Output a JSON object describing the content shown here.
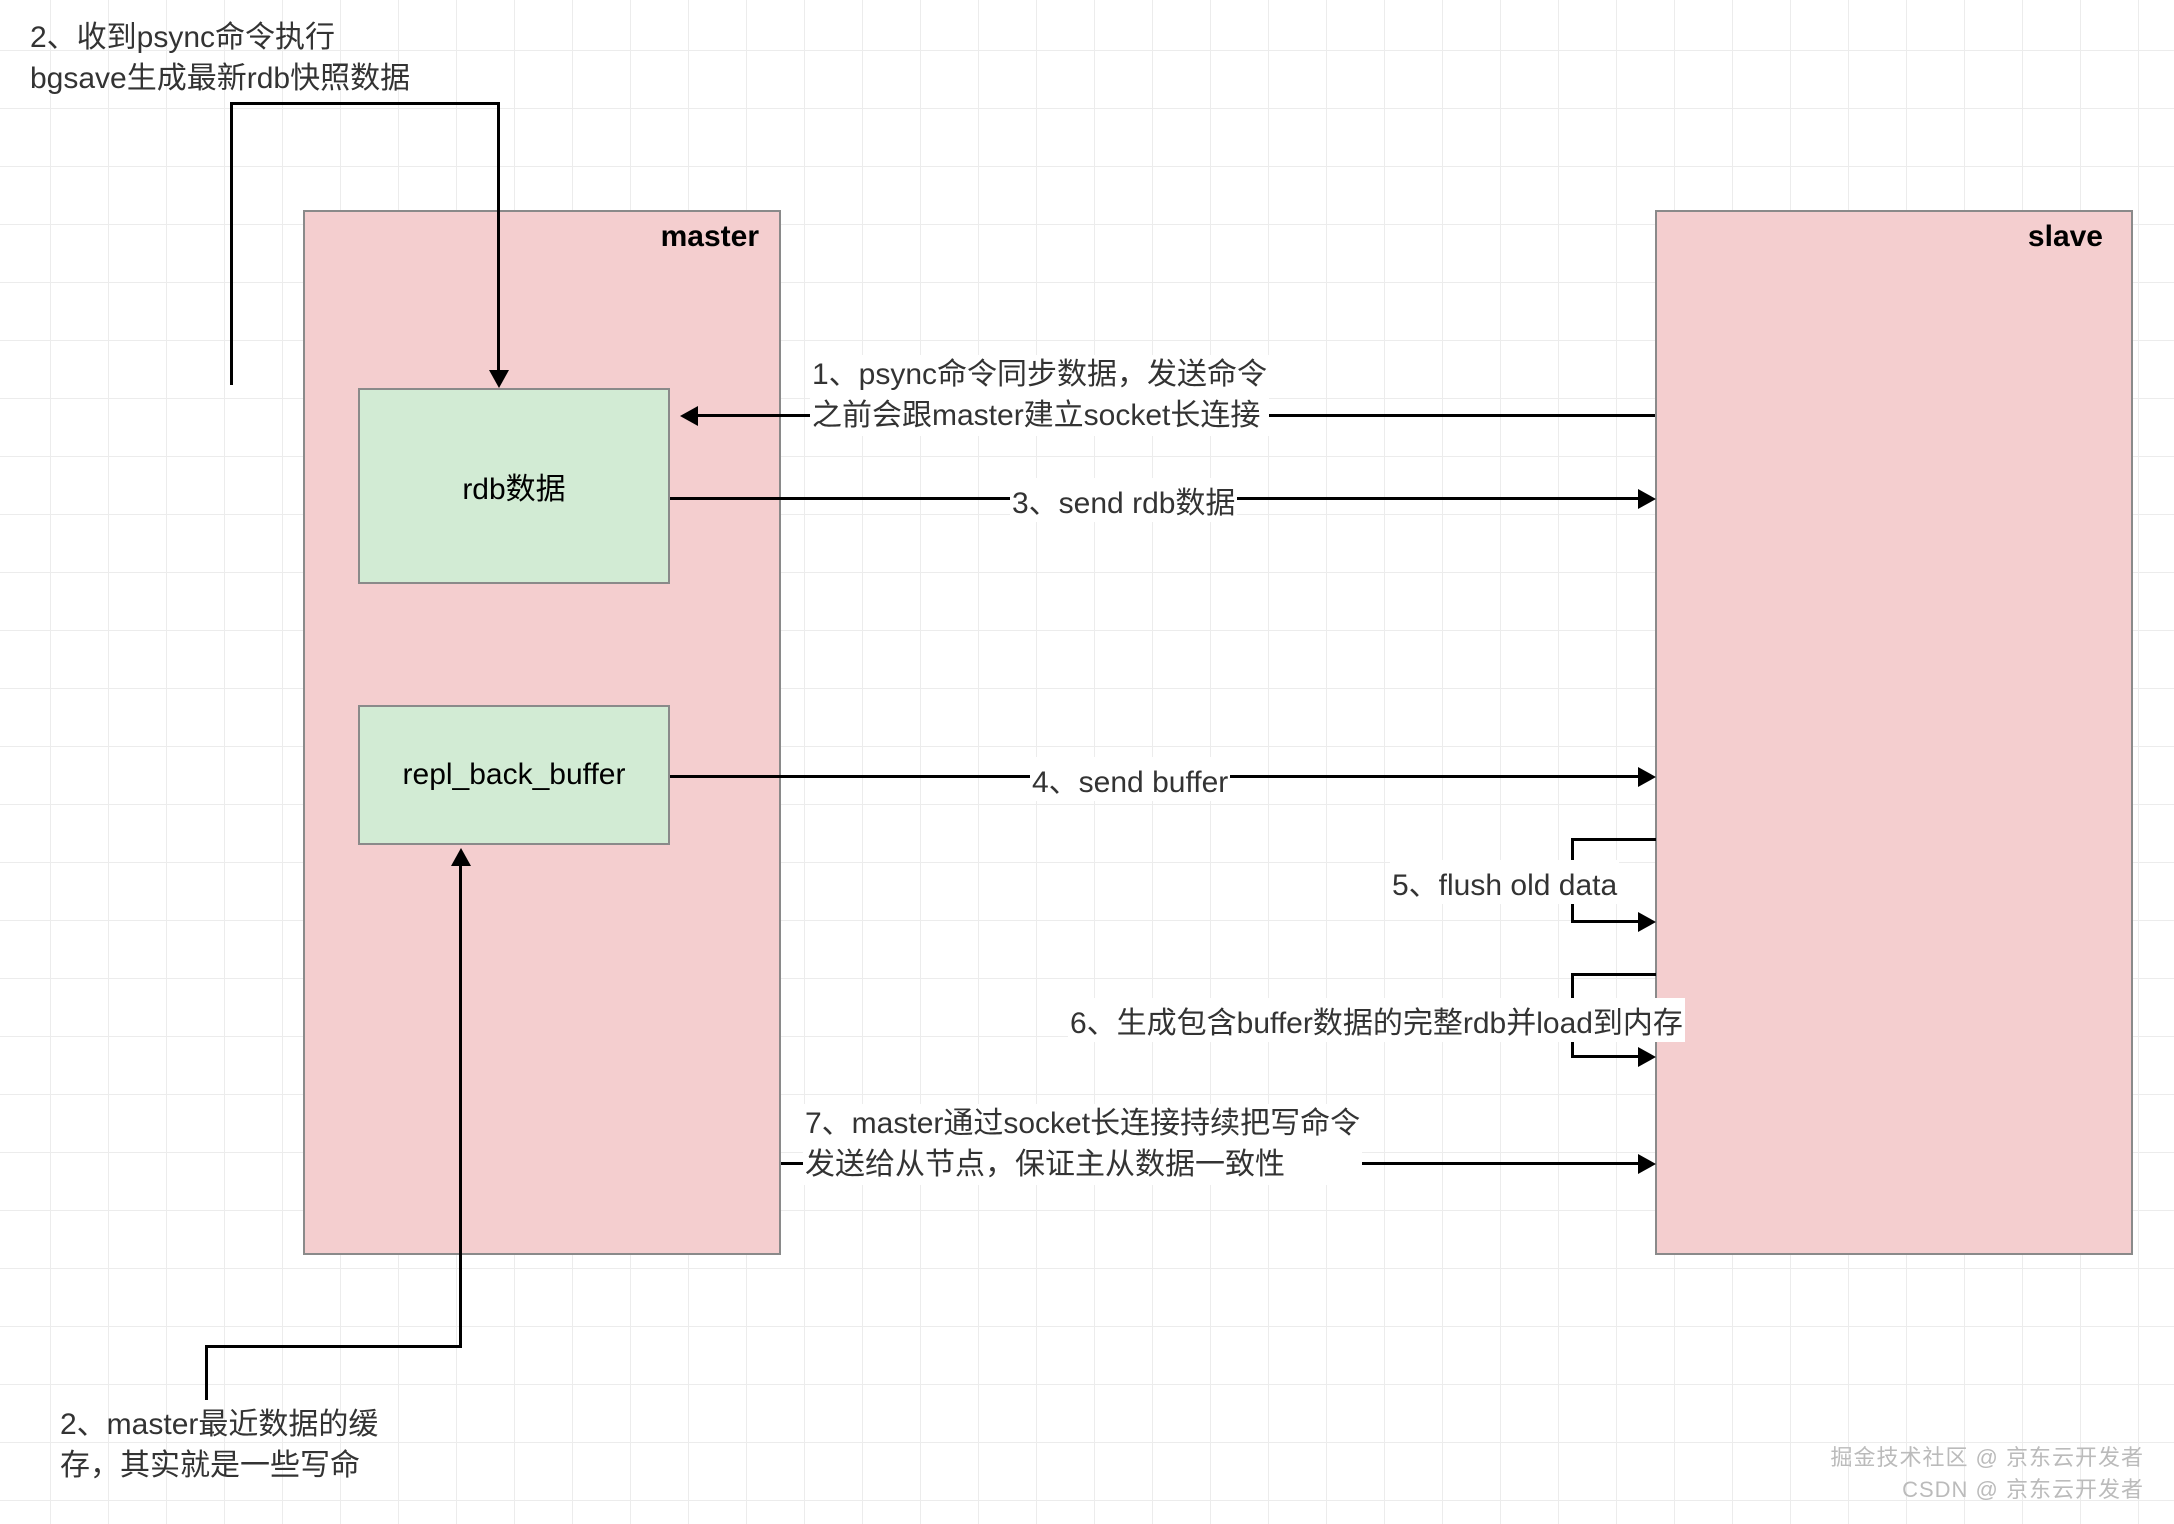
{
  "diagram": {
    "master": {
      "title": "master",
      "rdb_label": "rdb数据",
      "buffer_label": "repl_back_buffer"
    },
    "slave": {
      "title": "slave"
    },
    "annotations": {
      "step2a_line1": "2、收到psync命令执行",
      "step2a_line2": "bgsave生成最新rdb快照数据",
      "step2b_line1": "2、master最近数据的缓",
      "step2b_line2": "存，其实就是一些写命",
      "step1_line1": "1、psync命令同步数据，发送命令",
      "step1_line2": "之前会跟master建立socket长连接",
      "step3": "3、send rdb数据",
      "step4": "4、send buffer",
      "step5": "5、flush old data",
      "step6": "6、生成包含buffer数据的完整rdb并load到内存",
      "step7_line1": "7、master通过socket长连接持续把写命令",
      "step7_line2": "发送给从节点，保证主从数据一致性"
    },
    "watermarks": {
      "csdn": "CSDN @ 京东云开发者",
      "juejin": "掘金技术社区 @ 京东云开发者"
    }
  }
}
